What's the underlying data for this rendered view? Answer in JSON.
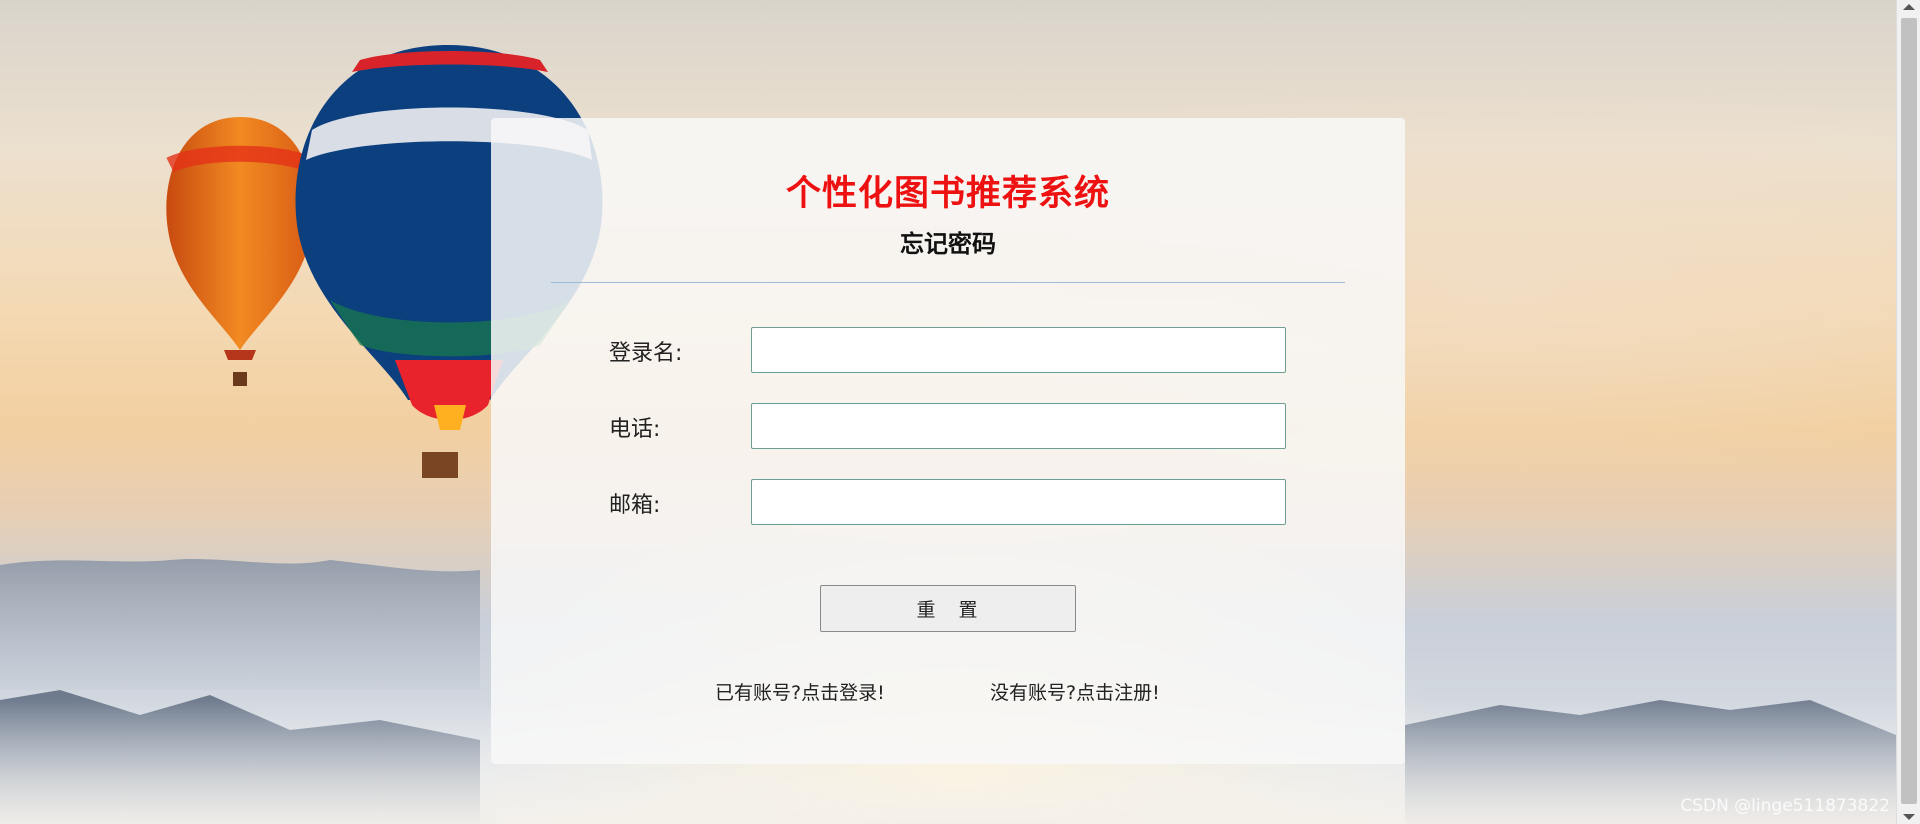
{
  "page": {
    "title": "个性化图书推荐系统",
    "subtitle": "忘记密码"
  },
  "form": {
    "fields": [
      {
        "label": "登录名:",
        "value": "",
        "placeholder": ""
      },
      {
        "label": "电话:",
        "value": "",
        "placeholder": ""
      },
      {
        "label": "邮箱:",
        "value": "",
        "placeholder": ""
      }
    ],
    "reset_label": "重　置"
  },
  "links": {
    "login": "已有账号?点击登录!",
    "register": "没有账号?点击注册!"
  },
  "watermark": "CSDN @linge511873822",
  "colors": {
    "title": "#ee1111",
    "input_border": "#6e9d93",
    "divider": "#9bbbd6"
  }
}
